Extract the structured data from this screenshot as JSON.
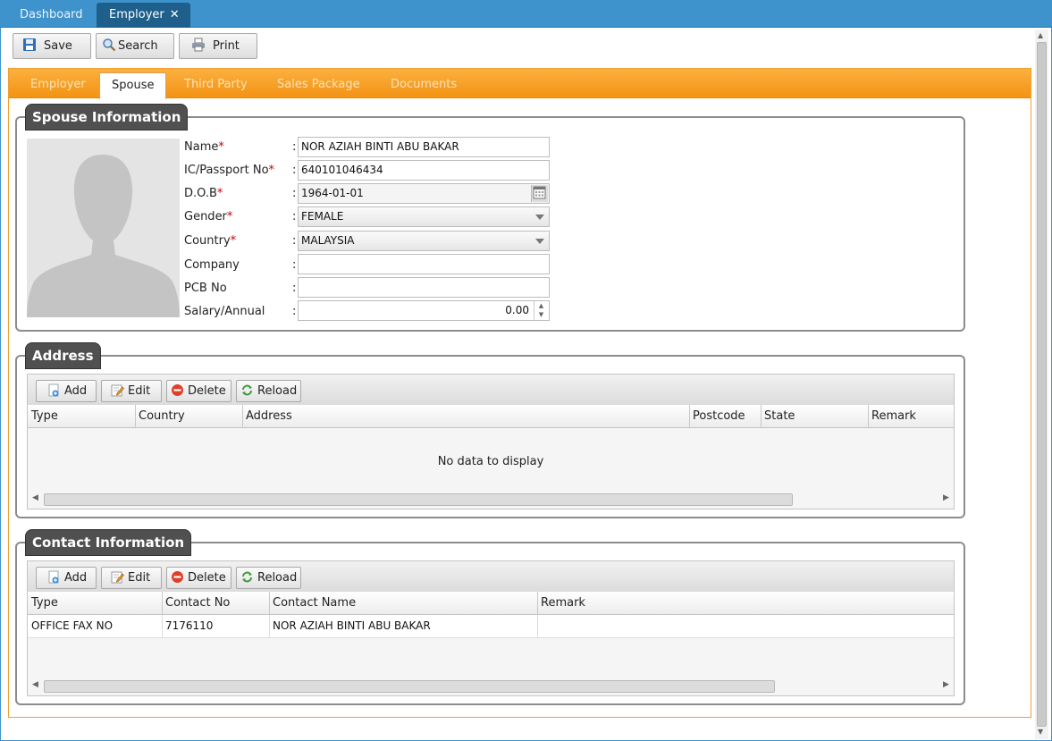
{
  "top_tabs": [
    {
      "label": "Dashboard"
    },
    {
      "label": "Employer",
      "close": "✕"
    }
  ],
  "toolbar": {
    "save_label": "Save",
    "search_label": "Search",
    "print_label": "Print"
  },
  "sub_tabs": [
    "Employer",
    "Spouse",
    "Third Party",
    "Sales Package",
    "Documents"
  ],
  "spouse": {
    "legend": "Spouse Information",
    "fields": [
      {
        "label": "Name",
        "required": "*",
        "value": "NOR AZIAH BINTI ABU BAKAR"
      },
      {
        "label": "IC/Passport No",
        "required": "*",
        "value": "640101046434"
      },
      {
        "label": "D.O.B",
        "required": "*",
        "value": "1964-01-01"
      },
      {
        "label": "Gender",
        "required": "*",
        "value": "FEMALE"
      },
      {
        "label": "Country",
        "required": "*",
        "value": "MALAYSIA"
      },
      {
        "label": "Company",
        "required": "",
        "value": ""
      },
      {
        "label": "PCB No",
        "required": "",
        "value": ""
      },
      {
        "label": "Salary/Annual",
        "required": "",
        "value": "0.00"
      }
    ]
  },
  "address": {
    "legend": "Address",
    "buttons": {
      "add": "Add",
      "edit": "Edit",
      "delete": "Delete",
      "reload": "Reload"
    },
    "columns": [
      "Type",
      "Country",
      "Address",
      "Postcode",
      "State",
      "Remark"
    ],
    "empty_text": "No data to display"
  },
  "contact": {
    "legend": "Contact Information",
    "buttons": {
      "add": "Add",
      "edit": "Edit",
      "delete": "Delete",
      "reload": "Reload"
    },
    "columns": [
      "Type",
      "Contact No",
      "Contact Name",
      "Remark"
    ],
    "rows": [
      {
        "type": "OFFICE FAX NO",
        "contact_no": "7176110",
        "contact_name": "NOR AZIAH BINTI ABU BAKAR",
        "remark": ""
      }
    ]
  },
  "colors": {
    "topbar": "#3f93cc",
    "tabstrip": "#f39314",
    "legend_bg": "#505050",
    "required": "#cc0000"
  }
}
